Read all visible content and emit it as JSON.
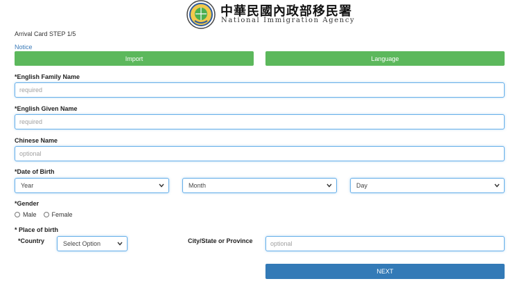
{
  "header": {
    "agency_name_cn": "中華民國內政部移民署",
    "agency_name_en": "National Immigration Agency",
    "logo_icon": "agency-emblem-icon"
  },
  "page": {
    "step_title": "Arrival Card STEP 1/5",
    "notice_link": "Notice"
  },
  "buttons": {
    "import_label": "Import",
    "language_label": "Language",
    "next_label": "NEXT"
  },
  "form": {
    "family_name": {
      "label": "*English Family Name",
      "placeholder": "required",
      "value": ""
    },
    "given_name": {
      "label": "*English Given Name",
      "placeholder": "required",
      "value": ""
    },
    "chinese_name": {
      "label": "Chinese Name",
      "placeholder": "optional",
      "value": ""
    },
    "dob": {
      "label": "*Date of Birth",
      "year_selected": "Year",
      "month_selected": "Month",
      "day_selected": "Day"
    },
    "gender": {
      "label": "*Gender",
      "options": [
        "Male",
        "Female"
      ]
    },
    "place_of_birth": {
      "label": "* Place of birth",
      "country_label": "*Country",
      "country_selected": "Select Option",
      "city_label": "City/State or Province",
      "city_placeholder": "optional",
      "city_value": ""
    }
  },
  "colors": {
    "green_button": "#5cb85c",
    "blue_button": "#337ab7",
    "input_border": "#66afe9",
    "notice_link": "#3a7ab8"
  }
}
